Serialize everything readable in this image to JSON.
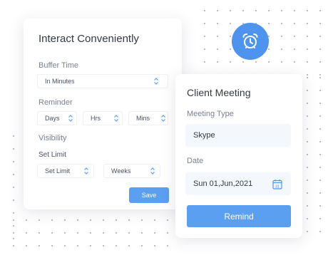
{
  "settings_card": {
    "title": "Interact Conveniently",
    "buffer_time_label": "Buffer Time",
    "buffer_select": "In Minutes",
    "reminder_label": "Reminder",
    "reminder_days": "Days",
    "reminder_hrs": "Hrs",
    "reminder_mins": "Mins",
    "visibility_label": "Visibility",
    "set_limit_label": "Set Limit",
    "set_limit_select": "Set Limit",
    "weeks_select": "Weeks",
    "save_label": "Save"
  },
  "meeting_card": {
    "title": "Client Meeting",
    "meeting_type_label": "Meeting Type",
    "meeting_type_value": "Skype",
    "date_label": "Date",
    "date_value": "Sun 01,Jun,2021",
    "calendar_day": "31",
    "remind_label": "Remind"
  },
  "colors": {
    "accent": "#5b9ff0",
    "alarm_circle": "#4e93ee",
    "chevron": "#5b9ff0"
  },
  "icons": [
    "alarm-clock-icon",
    "chevron-updown-icon",
    "calendar-icon"
  ]
}
